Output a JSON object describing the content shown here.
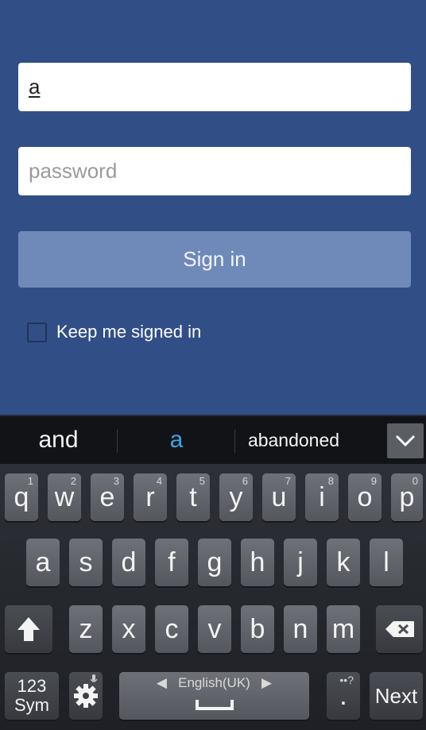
{
  "login": {
    "username_value": "a",
    "password_placeholder": "password",
    "signin_label": "Sign in",
    "keep_signed_in_label": "Keep me signed in",
    "keep_signed_in_checked": false
  },
  "suggestions": {
    "items": [
      "and",
      "a",
      "abandoned"
    ],
    "collapse_icon": "chevron-down-icon"
  },
  "keyboard": {
    "row1": [
      {
        "key": "q",
        "hint": "1"
      },
      {
        "key": "w",
        "hint": "2"
      },
      {
        "key": "e",
        "hint": "3"
      },
      {
        "key": "r",
        "hint": "4"
      },
      {
        "key": "t",
        "hint": "5"
      },
      {
        "key": "y",
        "hint": "6"
      },
      {
        "key": "u",
        "hint": "7"
      },
      {
        "key": "i",
        "hint": "8"
      },
      {
        "key": "o",
        "hint": "9"
      },
      {
        "key": "p",
        "hint": "0"
      }
    ],
    "row2": [
      "a",
      "s",
      "d",
      "f",
      "g",
      "h",
      "j",
      "k",
      "l"
    ],
    "row3": [
      "z",
      "x",
      "c",
      "v",
      "b",
      "n",
      "m"
    ],
    "shift_icon": "shift-arrow-icon",
    "backspace_icon": "backspace-icon",
    "sym_line1": "123",
    "sym_line2": "Sym",
    "settings_icon": "gear-icon",
    "space_language": "English(UK)",
    "period_label": ".",
    "period_hint": "••?",
    "next_label": "Next"
  }
}
